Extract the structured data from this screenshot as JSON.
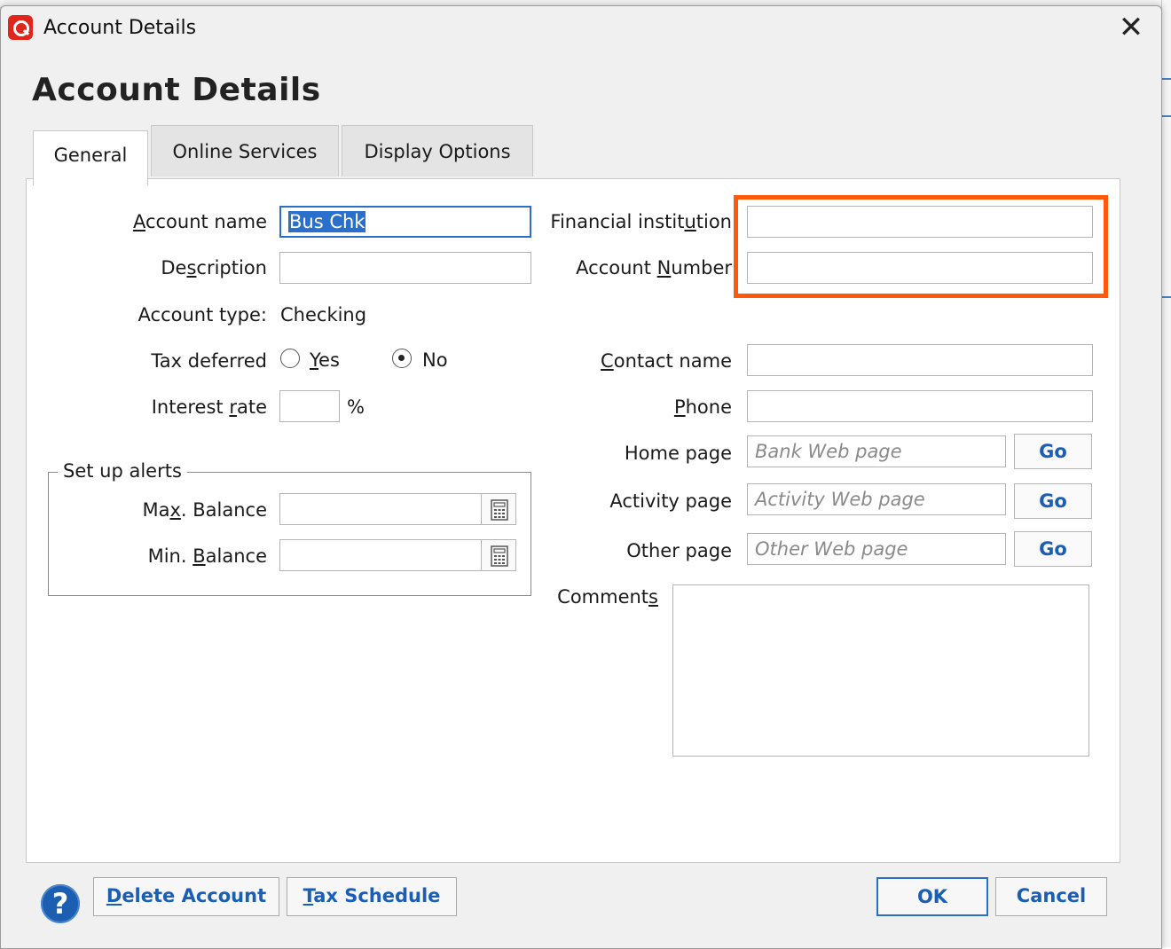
{
  "window": {
    "title": "Account Details",
    "close_glyph": "✕"
  },
  "heading": "Account Details",
  "tabs": [
    {
      "label": "General",
      "active": true
    },
    {
      "label": "Online Services",
      "active": false
    },
    {
      "label": "Display Options",
      "active": false
    }
  ],
  "general": {
    "account_name": {
      "label_pre": "",
      "label_u": "A",
      "label_post": "ccount name",
      "value": "Bus Chk"
    },
    "description": {
      "label_pre": "De",
      "label_u": "s",
      "label_post": "cription",
      "value": ""
    },
    "account_type": {
      "label": "Account type:",
      "value": "Checking"
    },
    "tax_deferred": {
      "label": "Tax deferred",
      "options": [
        {
          "label_u": "Y",
          "label_post": "es",
          "checked": false
        },
        {
          "label_u": "",
          "label_post": "No",
          "checked": true
        }
      ]
    },
    "interest_rate": {
      "label_pre": "Interest ",
      "label_u": "r",
      "label_post": "ate",
      "value": "",
      "unit": "%"
    },
    "alerts": {
      "title": "Set up alerts",
      "max_balance": {
        "label_pre": "Ma",
        "label_u": "x",
        "label_post": ". Balance",
        "value": ""
      },
      "min_balance": {
        "label_pre": "Min. ",
        "label_u": "B",
        "label_post": "alance",
        "value": ""
      }
    },
    "financial_institution": {
      "label_pre": "Financial instit",
      "label_u": "u",
      "label_post": "tion",
      "value": ""
    },
    "account_number": {
      "label_pre": "Account ",
      "label_u": "N",
      "label_post": "umber",
      "value": ""
    },
    "contact_name": {
      "label_pre": "",
      "label_u": "C",
      "label_post": "ontact name",
      "value": ""
    },
    "phone": {
      "label_pre": "",
      "label_u": "P",
      "label_post": "hone",
      "value": ""
    },
    "home_page": {
      "label": "Home page",
      "placeholder": "Bank Web page",
      "button": "Go"
    },
    "activity_page": {
      "label": "Activity page",
      "placeholder": "Activity Web page",
      "button": "Go"
    },
    "other_page": {
      "label": "Other page",
      "placeholder": "Other Web page",
      "button": "Go"
    },
    "comments": {
      "label_pre": "Comment",
      "label_u": "s",
      "label_post": "",
      "value": ""
    }
  },
  "footer": {
    "help_glyph": "?",
    "delete_account": {
      "label_u": "D",
      "label_post": "elete Account"
    },
    "tax_schedule": {
      "label_u": "T",
      "label_post": "ax Schedule"
    },
    "ok": "OK",
    "cancel": "Cancel"
  },
  "colors": {
    "highlight": "#ff5a0a",
    "accent": "#2a6fc9",
    "brand_icon": "#e1251b"
  },
  "icons": [
    "app-logo-icon",
    "close-icon",
    "calculator-icon",
    "help-icon"
  ]
}
